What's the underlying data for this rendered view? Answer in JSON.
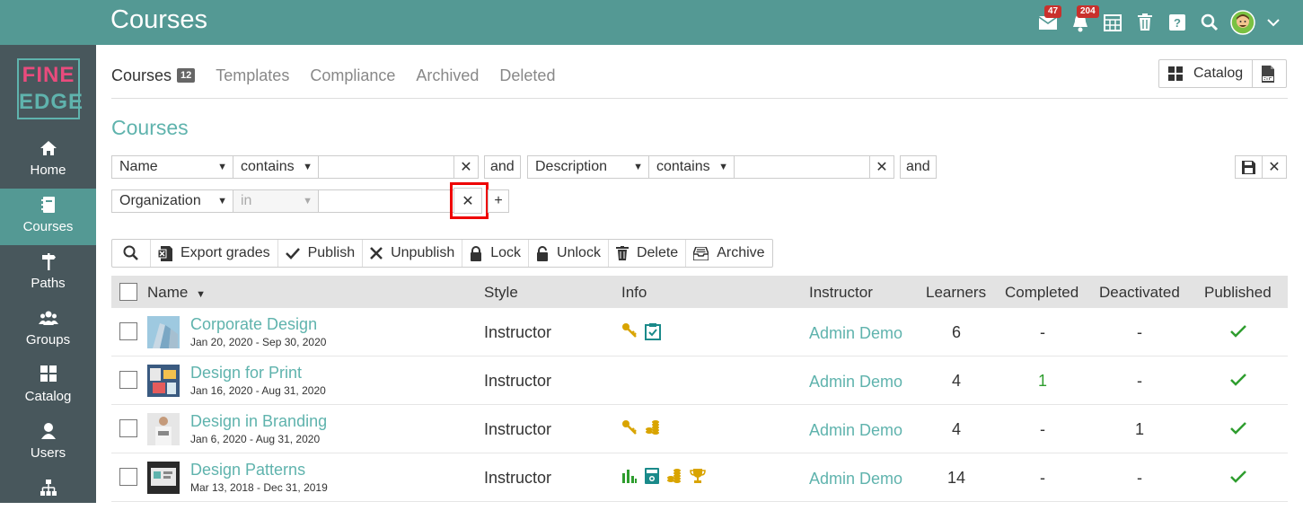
{
  "header": {
    "title": "Courses",
    "messages_badge": "47",
    "notifications_badge": "204"
  },
  "logo": {
    "line1": "FINE",
    "line2": "EDGE"
  },
  "sidebar": {
    "items": [
      {
        "label": "Home",
        "icon": "home-icon"
      },
      {
        "label": "Courses",
        "icon": "courses-icon"
      },
      {
        "label": "Paths",
        "icon": "paths-icon"
      },
      {
        "label": "Groups",
        "icon": "groups-icon"
      },
      {
        "label": "Catalog",
        "icon": "catalog-icon"
      },
      {
        "label": "Users",
        "icon": "users-icon"
      },
      {
        "label": "",
        "icon": "org-chart-icon"
      }
    ]
  },
  "tabs": [
    {
      "label": "Courses",
      "count": "12"
    },
    {
      "label": "Templates"
    },
    {
      "label": "Compliance"
    },
    {
      "label": "Archived"
    },
    {
      "label": "Deleted"
    }
  ],
  "catalog_button": "Catalog",
  "page_title": "Courses",
  "filters": {
    "row1": {
      "field1": "Name",
      "op1": "contains",
      "value1": "",
      "and1": "and",
      "field2": "Description",
      "op2": "contains",
      "value2": "",
      "and2": "and"
    },
    "row2": {
      "field": "Organization",
      "op": "in",
      "value": "",
      "add": "+"
    }
  },
  "toolbar": {
    "export": "Export grades",
    "publish": "Publish",
    "unpublish": "Unpublish",
    "lock": "Lock",
    "unlock": "Unlock",
    "delete": "Delete",
    "archive": "Archive"
  },
  "table": {
    "headers": {
      "name": "Name",
      "style": "Style",
      "info": "Info",
      "instructor": "Instructor",
      "learners": "Learners",
      "completed": "Completed",
      "deactivated": "Deactivated",
      "published": "Published"
    },
    "rows": [
      {
        "name": "Corporate Design",
        "dates": "Jan 20, 2020 - Sep 30, 2020",
        "style": "Instructor",
        "instructor": "Admin Demo",
        "learners": "6",
        "completed": "-",
        "deactivated": "-",
        "published": true,
        "info": [
          "key-icon",
          "clipboard-check-icon"
        ]
      },
      {
        "name": "Design for Print",
        "dates": "Jan 16, 2020 - Aug 31, 2020",
        "style": "Instructor",
        "instructor": "Admin Demo",
        "learners": "4",
        "completed": "1",
        "deactivated": "-",
        "published": true,
        "info": []
      },
      {
        "name": "Design in Branding",
        "dates": "Jan 6, 2020 - Aug 31, 2020",
        "style": "Instructor",
        "instructor": "Admin Demo",
        "learners": "4",
        "completed": "-",
        "deactivated": "1",
        "published": true,
        "info": [
          "key-icon",
          "coins-icon"
        ]
      },
      {
        "name": "Design Patterns",
        "dates": "Mar 13, 2018 - Dec 31, 2019",
        "style": "Instructor",
        "instructor": "Admin Demo",
        "learners": "14",
        "completed": "-",
        "deactivated": "-",
        "published": true,
        "info": [
          "bar-chart-icon",
          "calculator-icon",
          "coins-icon",
          "trophy-icon"
        ]
      }
    ]
  },
  "colors": {
    "topbar": "#549994",
    "sidebar": "#48575c",
    "accent": "#5fb3ad",
    "badge": "#c9302c",
    "check": "#2e9d2e",
    "gold": "#d9a400"
  }
}
